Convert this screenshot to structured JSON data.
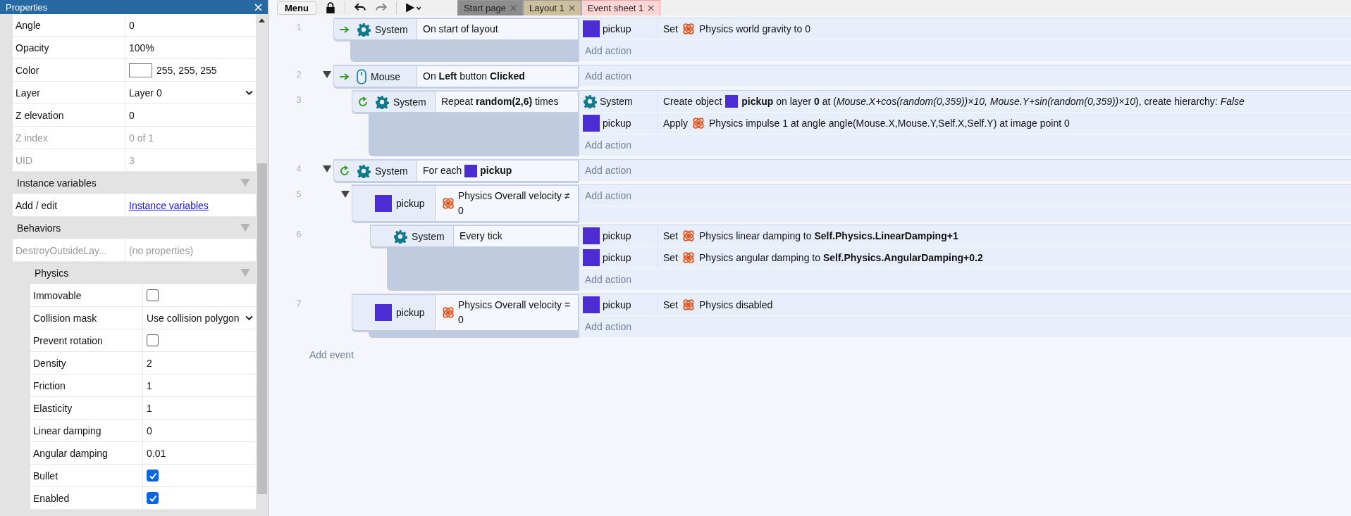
{
  "properties": {
    "title": "Properties",
    "rows": [
      {
        "kind": "text",
        "label": "Angle",
        "value": "0",
        "disabled": false
      },
      {
        "kind": "text",
        "label": "Opacity",
        "value": "100%",
        "disabled": false
      },
      {
        "kind": "color",
        "label": "Color",
        "value": "255, 255, 255",
        "color": "#ffffff",
        "disabled": false
      },
      {
        "kind": "select",
        "label": "Layer",
        "value": "Layer 0",
        "disabled": false
      },
      {
        "kind": "text",
        "label": "Z elevation",
        "value": "0",
        "disabled": false
      },
      {
        "kind": "text",
        "label": "Z index",
        "value": "0 of 1",
        "disabled": true
      },
      {
        "kind": "text",
        "label": "UID",
        "value": "3",
        "disabled": true
      },
      {
        "kind": "section",
        "label": "Instance variables",
        "expanded": true,
        "children": [
          {
            "kind": "link",
            "label": "Add / edit",
            "value": "Instance variables",
            "disabled": false
          }
        ]
      },
      {
        "kind": "section",
        "label": "Behaviors",
        "expanded": true,
        "children": [
          {
            "kind": "text",
            "label": "DestroyOutsideLay...",
            "value": "(no properties)",
            "disabled": true
          },
          {
            "kind": "section",
            "label": "Physics",
            "expanded": true,
            "children": [
              {
                "kind": "checkbox",
                "label": "Immovable",
                "checked": false,
                "disabled": false
              },
              {
                "kind": "select",
                "label": "Collision mask",
                "value": "Use collision polygon",
                "disabled": false
              },
              {
                "kind": "checkbox",
                "label": "Prevent rotation",
                "checked": false,
                "disabled": false
              },
              {
                "kind": "text",
                "label": "Density",
                "value": "2",
                "disabled": false
              },
              {
                "kind": "text",
                "label": "Friction",
                "value": "1",
                "disabled": false
              },
              {
                "kind": "text",
                "label": "Elasticity",
                "value": "1",
                "disabled": false
              },
              {
                "kind": "text",
                "label": "Linear damping",
                "value": "0",
                "disabled": false
              },
              {
                "kind": "text",
                "label": "Angular damping",
                "value": "0.01",
                "disabled": false
              },
              {
                "kind": "checkbox",
                "label": "Bullet",
                "checked": true,
                "disabled": false
              },
              {
                "kind": "checkbox",
                "label": "Enabled",
                "checked": true,
                "disabled": false
              }
            ]
          }
        ]
      }
    ]
  },
  "toolbar": {
    "menu": "Menu"
  },
  "tabs": [
    {
      "label": "Start page",
      "selected": false,
      "color": "#8c8c8c"
    },
    {
      "label": "Layout 1",
      "selected": false,
      "color": "#cbbf9e"
    },
    {
      "label": "Event sheet 1",
      "selected": true,
      "color": "#fcd6d6"
    }
  ],
  "events": [
    {
      "number": "1",
      "conditions": [
        {
          "kind": "trigger",
          "object": {
            "kind": "system",
            "name": "System"
          },
          "text": "On start of layout"
        }
      ],
      "actions": [
        {
          "kind": "behavior",
          "object": {
            "kind": "sprite",
            "name": "pickup"
          },
          "verb": "Set",
          "text": "Physics world gravity to 0"
        }
      ],
      "add_action": "Add action"
    },
    {
      "number": "2",
      "expanded": true,
      "conditions": [
        {
          "kind": "trigger",
          "object": {
            "kind": "mouse",
            "name": "Mouse"
          },
          "text": "On **Left** button **Clicked**"
        }
      ],
      "add_action": "Add action",
      "children": [
        {
          "number": "3",
          "conditions": [
            {
              "kind": "loop",
              "object": {
                "kind": "system",
                "name": "System"
              },
              "text": "Repeat **random(2,6)** times"
            }
          ],
          "actions": [
            {
              "kind": "create",
              "object": {
                "kind": "system",
                "name": "System"
              },
              "verb": "Create object",
              "text": "**pickup** on layer **0** at (*Mouse.X+cos(random(0,359))×10, Mouse.Y+sin(random(0,359))×10*), create hierarchy: *False*"
            },
            {
              "kind": "behavior",
              "object": {
                "kind": "sprite",
                "name": "pickup"
              },
              "verb": "Apply",
              "text": "Physics impulse 1 at angle angle(Mouse.X,Mouse.Y,Self.X,Self.Y) at image point 0"
            }
          ],
          "add_action": "Add action"
        }
      ]
    },
    {
      "number": "4",
      "expanded": true,
      "conditions": [
        {
          "kind": "loop_object",
          "object": {
            "kind": "system",
            "name": "System"
          },
          "prefix": "For each",
          "text": "**pickup**"
        }
      ],
      "add_action": "Add action",
      "children": [
        {
          "number": "5",
          "expanded": true,
          "conditions": [
            {
              "kind": "behavior",
              "object": {
                "kind": "sprite",
                "name": "pickup"
              },
              "text": "Physics Overall velocity ≠ 0"
            }
          ],
          "add_action": "Add action",
          "children": [
            {
              "number": "6",
              "conditions": [
                {
                  "kind": "plain",
                  "object": {
                    "kind": "system",
                    "name": "System"
                  },
                  "text": "Every tick"
                }
              ],
              "actions": [
                {
                  "kind": "behavior",
                  "object": {
                    "kind": "sprite",
                    "name": "pickup"
                  },
                  "verb": "Set",
                  "text": "Physics linear damping to **Self.Physics.LinearDamping+1**"
                },
                {
                  "kind": "behavior",
                  "object": {
                    "kind": "sprite",
                    "name": "pickup"
                  },
                  "verb": "Set",
                  "text": "Physics angular damping to **Self.Physics.AngularDamping+0.2**"
                }
              ],
              "add_action": "Add action"
            }
          ]
        },
        {
          "number": "7",
          "conditions": [
            {
              "kind": "behavior",
              "object": {
                "kind": "sprite",
                "name": "pickup"
              },
              "text": "Physics Overall velocity = 0"
            }
          ],
          "actions": [
            {
              "kind": "behavior",
              "object": {
                "kind": "sprite",
                "name": "pickup"
              },
              "verb": "Set",
              "text": "Physics disabled"
            }
          ],
          "add_action": "Add action"
        }
      ]
    }
  ],
  "add_event": "Add event"
}
